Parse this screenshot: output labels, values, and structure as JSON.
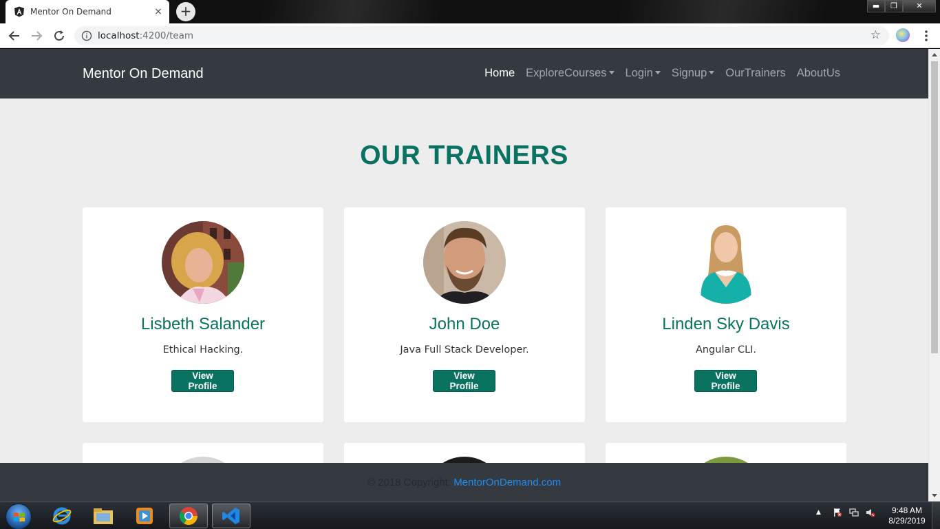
{
  "browser": {
    "tab_title": "Mentor On Demand",
    "tab_close": "×",
    "new_tab": "+",
    "url_host": "localhost",
    "url_path": ":4200/team",
    "window_minimize": "▬",
    "window_restore": "❐",
    "window_close": "✕",
    "icons": [
      "angular-favicon",
      "back-arrow-icon",
      "forward-arrow-icon",
      "reload-icon",
      "info-icon",
      "star-icon",
      "profile-avatar",
      "menu-dots-icon"
    ]
  },
  "site": {
    "brand": "Mentor On Demand",
    "nav": [
      {
        "label": "Home",
        "active": true,
        "dropdown": false
      },
      {
        "label": "ExploreCourses",
        "active": false,
        "dropdown": true
      },
      {
        "label": "Login",
        "active": false,
        "dropdown": true
      },
      {
        "label": "Signup",
        "active": false,
        "dropdown": true
      },
      {
        "label": "OurTrainers",
        "active": false,
        "dropdown": false
      },
      {
        "label": "AboutUs",
        "active": false,
        "dropdown": false
      }
    ],
    "title": "OUR TRAINERS",
    "trainers": [
      {
        "name": "Lisbeth Salander",
        "role": "Ethical Hacking.",
        "button": "View Profile"
      },
      {
        "name": "John Doe",
        "role": "Java Full Stack Developer.",
        "button": "View Profile"
      },
      {
        "name": "Linden Sky Davis",
        "role": "Angular CLI.",
        "button": "View Profile"
      }
    ],
    "footer": {
      "copyright": "© 2018 Copyright:",
      "link": "MentorOnDemand.com"
    }
  },
  "taskbar": {
    "apps": [
      "internet-explorer-icon",
      "file-explorer-icon",
      "media-player-icon",
      "chrome-icon",
      "vscode-icon"
    ],
    "active_apps": [
      "chrome-icon",
      "vscode-icon"
    ],
    "tray_arrow": "▲",
    "time": "9:48 AM",
    "date": "8/29/2019"
  },
  "colors": {
    "brand_green": "#0a7260",
    "navbar": "#343a40",
    "page_bg": "#ededed",
    "footer_link": "#1f8cf0"
  }
}
